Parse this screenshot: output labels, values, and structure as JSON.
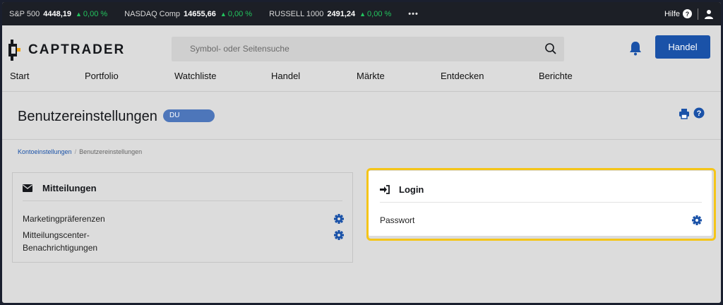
{
  "ticker": {
    "items": [
      {
        "name": "S&P 500",
        "value": "4448,19",
        "change": "0,00 %"
      },
      {
        "name": "NASDAQ Comp",
        "value": "14655,66",
        "change": "0,00 %"
      },
      {
        "name": "RUSSELL 1000",
        "value": "2491,24",
        "change": "0,00 %"
      }
    ],
    "more": "•••",
    "help_label": "Hilfe",
    "positive_color": "#22c55e"
  },
  "header": {
    "logo_text": "CAPTRADER",
    "search_placeholder": "Symbol- oder Seitensuche",
    "trade_button": "Handel",
    "accent_color": "#1a52a8"
  },
  "nav": {
    "items": [
      "Start",
      "Portfolio",
      "Watchliste",
      "Handel",
      "Märkte",
      "Entdecken",
      "Berichte"
    ]
  },
  "page": {
    "title": "Benutzereinstellungen",
    "badge": "DU"
  },
  "breadcrumb": {
    "parent": "Kontoeinstellungen",
    "separator": "/",
    "current": "Benutzereinstellungen"
  },
  "panels": {
    "messages": {
      "title": "Mitteilungen",
      "rows": [
        {
          "label": "Marketingpräferenzen"
        },
        {
          "label_line1": "Mitteilungscenter-",
          "label_line2": "Benachrichtigungen"
        }
      ]
    },
    "login": {
      "title": "Login",
      "rows": [
        {
          "label": "Passwort"
        }
      ],
      "highlight_color": "#f5c518"
    }
  }
}
